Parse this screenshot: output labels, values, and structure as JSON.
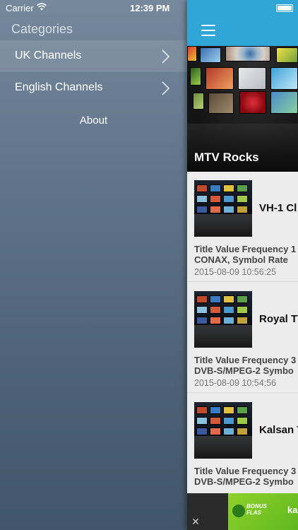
{
  "status_bar": {
    "carrier": "Carrier",
    "time": "12:39 PM"
  },
  "drawer": {
    "header": "Categories",
    "items": [
      {
        "label": "UK Channels",
        "selected": true
      },
      {
        "label": "English Channels",
        "selected": false
      }
    ],
    "about": "About"
  },
  "main": {
    "hero_title": "MTV Rocks",
    "cards": [
      {
        "title": "VH-1 Cl",
        "desc_line1": "Title Value Frequency 1",
        "desc_line2": "CONAX, Symbol Rate",
        "date": "2015-08-09 10:56:25"
      },
      {
        "title": "Royal TV",
        "desc_line1": "Title Value Frequency 3",
        "desc_line2": "DVB-S/MPEG-2  Symbo",
        "date": "2015-08-09 10:54:56"
      },
      {
        "title": "Kalsan T",
        "desc_line1": "Title Value Frequency 3",
        "desc_line2": "DVB-S/MPEG-2  Symbo",
        "date": ""
      }
    ]
  },
  "ad": {
    "close": "✕",
    "bonus_text": "BONUS FLAS",
    "brand": "ka"
  },
  "colors": {
    "navbar": "#2fa6d6",
    "drawer_top": "#75889c",
    "drawer_bottom": "#41566a"
  },
  "icons": [
    "wifi-icon",
    "battery-icon",
    "hamburger-menu-icon",
    "chevron-right-icon",
    "close-icon"
  ]
}
